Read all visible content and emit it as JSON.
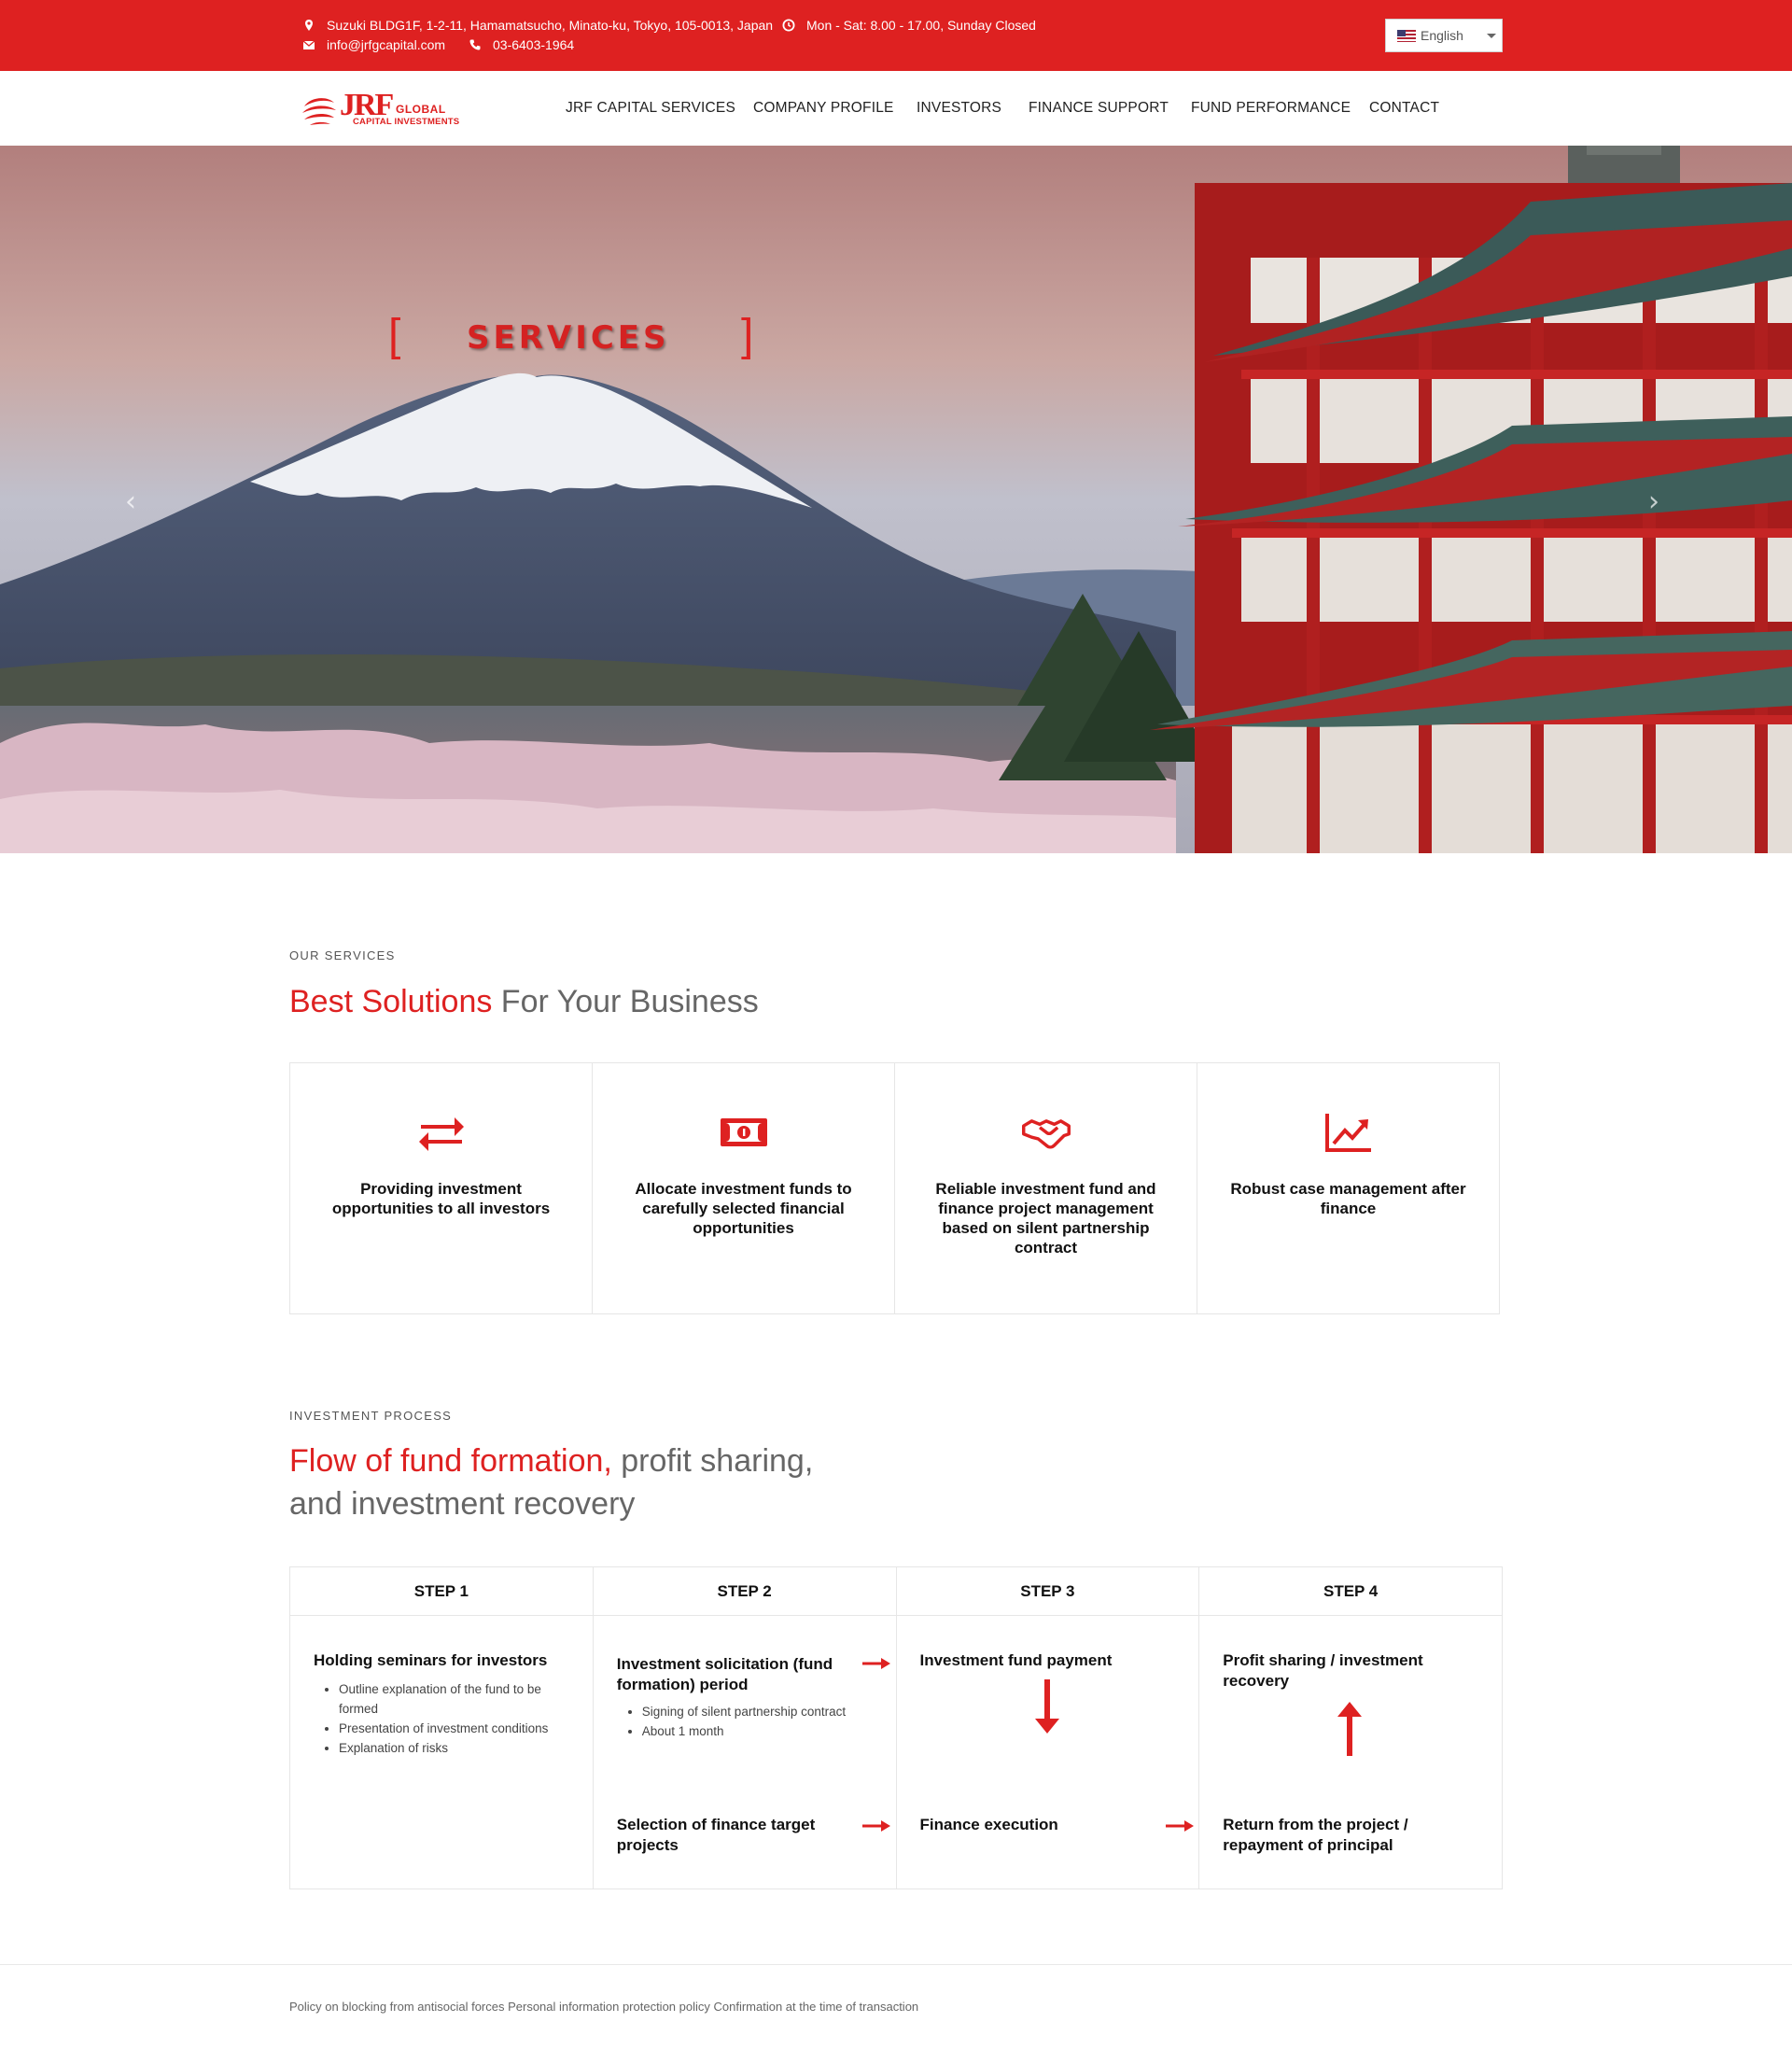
{
  "topbar": {
    "address": "Suzuki BLDG1F, 1-2-11, Hamamatsucho, Minato-ku, Tokyo, 105-0013, Japan",
    "hours": "Mon - Sat: 8.00 - 17.00, Sunday Closed",
    "email": "info@jrfgcapital.com",
    "phone": "03-6403-1964",
    "language": "English"
  },
  "logo": {
    "mark": "JRF",
    "line1": "GLOBAL",
    "line2": "CAPITAL INVESTMENTS"
  },
  "nav": {
    "items": [
      {
        "label": "JRF CAPITAL SERVICES"
      },
      {
        "label": "COMPANY PROFILE"
      },
      {
        "label": "INVESTORS"
      },
      {
        "label": "FINANCE SUPPORT"
      },
      {
        "label": "FUND PERFORMANCE"
      },
      {
        "label": "CONTACT"
      }
    ]
  },
  "hero": {
    "bracket_left": "[",
    "title": "SERVICES",
    "bracket_right": "]",
    "prev": "‹",
    "next": "›"
  },
  "services": {
    "eyebrow": "OUR SERVICES",
    "heading_red": "Best Solutions",
    "heading_rest": " For Your Business",
    "cards": [
      {
        "icon": "exchange-arrows-icon",
        "text": "Providing investment opportunities to all investors"
      },
      {
        "icon": "money-bill-icon",
        "text": "Allocate investment funds to carefully selected financial opportunities"
      },
      {
        "icon": "handshake-icon",
        "text": "Reliable investment fund and finance project management based on silent partnership contract"
      },
      {
        "icon": "chart-line-icon",
        "text": "Robust case management after finance"
      }
    ]
  },
  "process": {
    "eyebrow": "INVESTMENT PROCESS",
    "heading_red": "Flow of fund formation,",
    "heading_rest1": " profit sharing,",
    "heading_rest2": "and investment recovery",
    "steps": [
      {
        "label": "STEP 1",
        "title": "Holding seminars for investors",
        "bullets": [
          "Outline explanation of the fund to be formed",
          "Presentation of investment conditions",
          "Explanation of risks"
        ]
      },
      {
        "label": "STEP 2",
        "title": "Investment solicitation (fund formation) period",
        "bullets": [
          "Signing of silent partnership contract",
          "About 1 month"
        ],
        "bottom": "Selection of finance target projects"
      },
      {
        "label": "STEP 3",
        "title": "Investment fund payment",
        "bottom": "Finance execution"
      },
      {
        "label": "STEP 4",
        "title": "Profit sharing / investment recovery",
        "bottom": "Return from the project / repayment of principal"
      }
    ]
  },
  "footer": {
    "links": "Policy on blocking from antisocial forces Personal information protection policy Confirmation at the time of transaction"
  },
  "colors": {
    "brand_red": "#de2121",
    "text_dark": "#111111",
    "text_grey": "#666666"
  }
}
